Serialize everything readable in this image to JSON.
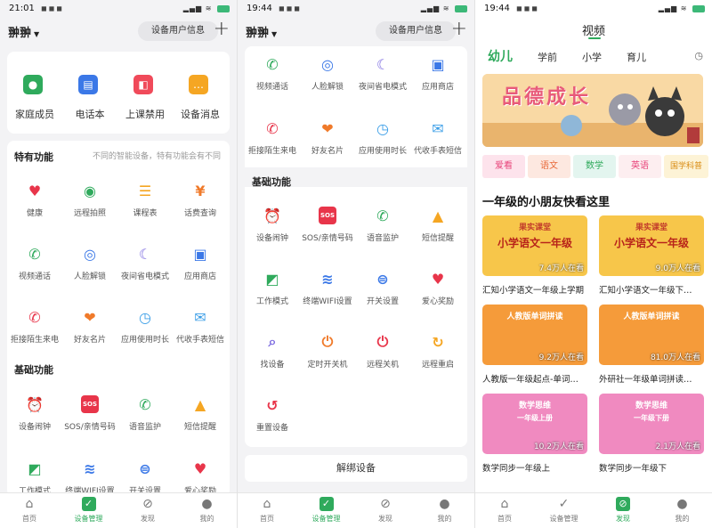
{
  "p1": {
    "status": {
      "time": "21:01",
      "battery": "79"
    },
    "device_name": "翀翀",
    "info_button": "设备用户信息",
    "top_items": [
      {
        "label": "家庭成员",
        "icon": "family-icon",
        "color": "#2faa5c"
      },
      {
        "label": "电话本",
        "icon": "phonebook-icon",
        "color": "#3b78e7"
      },
      {
        "label": "上课禁用",
        "icon": "class-ban-icon",
        "color": "#f04a5a"
      },
      {
        "label": "设备消息",
        "icon": "message-icon",
        "color": "#f5a623"
      }
    ],
    "special_title": "特有功能",
    "special_hint": "不同的智能设备，特有功能会有不同",
    "special_items": [
      {
        "label": "健康",
        "icon": "heart-icon",
        "color": "#e8354a"
      },
      {
        "label": "远程拍照",
        "icon": "camera-icon",
        "color": "#2faa5c"
      },
      {
        "label": "课程表",
        "icon": "schedule-icon",
        "color": "#f5a623"
      },
      {
        "label": "话费查询",
        "icon": "yen-icon",
        "color": "#f07a2a"
      },
      {
        "label": "视频通话",
        "icon": "video-call-icon",
        "color": "#2faa5c"
      },
      {
        "label": "人脸解锁",
        "icon": "face-unlock-icon",
        "color": "#3b78e7"
      },
      {
        "label": "夜间省电模式",
        "icon": "moon-icon",
        "color": "#7b6ae0"
      },
      {
        "label": "应用商店",
        "icon": "store-icon",
        "color": "#3b78e7"
      },
      {
        "label": "拒接陌生来电",
        "icon": "reject-call-icon",
        "color": "#e8354a"
      },
      {
        "label": "好友名片",
        "icon": "friend-card-icon",
        "color": "#f07a2a"
      },
      {
        "label": "应用使用时长",
        "icon": "clock-icon",
        "color": "#3b9ee7"
      },
      {
        "label": "代收手表短信",
        "icon": "sms-icon",
        "color": "#3b9ee7"
      }
    ],
    "basic_title": "基础功能",
    "basic_items": [
      {
        "label": "设备闹钟",
        "icon": "alarm-icon",
        "color": "#3b78e7"
      },
      {
        "label": "SOS/亲情号码",
        "icon": "sos-icon",
        "color": "#e8354a"
      },
      {
        "label": "语音监护",
        "icon": "voice-monitor-icon",
        "color": "#2faa5c"
      },
      {
        "label": "短信提醒",
        "icon": "bell-icon",
        "color": "#f5a623"
      },
      {
        "label": "工作模式",
        "icon": "work-mode-icon",
        "color": "#2faa5c"
      },
      {
        "label": "终端WIFI设置",
        "icon": "wifi-icon",
        "color": "#3b78e7"
      },
      {
        "label": "开关设置",
        "icon": "toggle-icon",
        "color": "#3b78e7"
      },
      {
        "label": "爱心奖励",
        "icon": "love-reward-icon",
        "color": "#e8354a"
      }
    ]
  },
  "p2": {
    "status": {
      "time": "19:44",
      "battery": "95"
    },
    "device_name": "翀翀",
    "info_button": "设备用户信息",
    "special_items": [
      {
        "label": "视频通话",
        "icon": "video-call-icon",
        "color": "#2faa5c"
      },
      {
        "label": "人脸解锁",
        "icon": "face-unlock-icon",
        "color": "#3b78e7"
      },
      {
        "label": "夜间省电模式",
        "icon": "moon-icon",
        "color": "#7b6ae0"
      },
      {
        "label": "应用商店",
        "icon": "store-icon",
        "color": "#3b78e7"
      },
      {
        "label": "拒接陌生来电",
        "icon": "reject-call-icon",
        "color": "#e8354a"
      },
      {
        "label": "好友名片",
        "icon": "friend-card-icon",
        "color": "#f07a2a"
      },
      {
        "label": "应用使用时长",
        "icon": "clock-icon",
        "color": "#3b9ee7"
      },
      {
        "label": "代收手表短信",
        "icon": "sms-icon",
        "color": "#3b9ee7"
      }
    ],
    "basic_title": "基础功能",
    "basic_items": [
      {
        "label": "设备闹钟",
        "icon": "alarm-icon",
        "color": "#3b78e7"
      },
      {
        "label": "SOS/亲情号码",
        "icon": "sos-icon",
        "color": "#e8354a"
      },
      {
        "label": "语音监护",
        "icon": "voice-monitor-icon",
        "color": "#2faa5c"
      },
      {
        "label": "短信提醒",
        "icon": "bell-icon",
        "color": "#f5a623"
      },
      {
        "label": "工作模式",
        "icon": "work-mode-icon",
        "color": "#2faa5c"
      },
      {
        "label": "终端WIFI设置",
        "icon": "wifi-icon",
        "color": "#3b78e7"
      },
      {
        "label": "开关设置",
        "icon": "toggle-icon",
        "color": "#3b78e7"
      },
      {
        "label": "爱心奖励",
        "icon": "love-reward-icon",
        "color": "#e8354a"
      },
      {
        "label": "找设备",
        "icon": "search-icon",
        "color": "#7b6ae0"
      },
      {
        "label": "定时开关机",
        "icon": "timer-power-icon",
        "color": "#f07a2a"
      },
      {
        "label": "远程关机",
        "icon": "power-icon",
        "color": "#e8354a"
      },
      {
        "label": "远程重启",
        "icon": "restart-icon",
        "color": "#f5a623"
      },
      {
        "label": "重置设备",
        "icon": "reset-icon",
        "color": "#e8354a"
      }
    ],
    "unbind_label": "解绑设备"
  },
  "p3": {
    "status": {
      "time": "19:44",
      "battery": "95"
    },
    "title": "视频",
    "category_tabs": [
      "幼儿",
      "学前",
      "小学",
      "育儿"
    ],
    "banner_text": "品德成长",
    "chips": [
      {
        "label": "爱看",
        "bg": "#fde3ec",
        "fg": "#e8447a"
      },
      {
        "label": "语文",
        "bg": "#fde8e0",
        "fg": "#e86a3a"
      },
      {
        "label": "数学",
        "bg": "#e3f5ef",
        "fg": "#2faa5c"
      },
      {
        "label": "英语",
        "bg": "#fdeef0",
        "fg": "#e8447a"
      },
      {
        "label": "国学科普",
        "bg": "#fdf3d6",
        "fg": "#d98b12"
      }
    ],
    "section_title": "一年级的小朋友快看这里",
    "videos": [
      {
        "title": "汇知小学语文一年级上学期",
        "views": "7.4万人在看",
        "banner": "果实课堂",
        "subtitle": "小学语文一年级",
        "bg": "#f7c64a"
      },
      {
        "title": "汇知小学语文一年级下…",
        "views": "9.0万人在看",
        "banner": "果实课堂",
        "subtitle": "小学语文一年级",
        "bg": "#f7c64a"
      },
      {
        "title": "人教版一年级起点-单词…",
        "views": "9.2万人在看",
        "banner": "人教版单词拼读",
        "subtitle": "",
        "bg": "#f59b3a"
      },
      {
        "title": "外研社一年级单词拼读…",
        "views": "81.0万人在看",
        "banner": "人教版单词拼读",
        "subtitle": "",
        "bg": "#f59b3a"
      },
      {
        "title": "数学同步一年级上",
        "views": "10.2万人在看",
        "banner": "数学思维",
        "subtitle": "一年级上册",
        "bg": "#f08ac0"
      },
      {
        "title": "数学同步一年级下",
        "views": "2.1万人在看",
        "banner": "数学思维",
        "subtitle": "一年级下册",
        "bg": "#f08ac0"
      }
    ]
  },
  "tabs": [
    {
      "label": "首页",
      "icon": "home-icon"
    },
    {
      "label": "设备管理",
      "icon": "device-manage-icon"
    },
    {
      "label": "发现",
      "icon": "discover-icon"
    },
    {
      "label": "我的",
      "icon": "profile-icon"
    }
  ]
}
